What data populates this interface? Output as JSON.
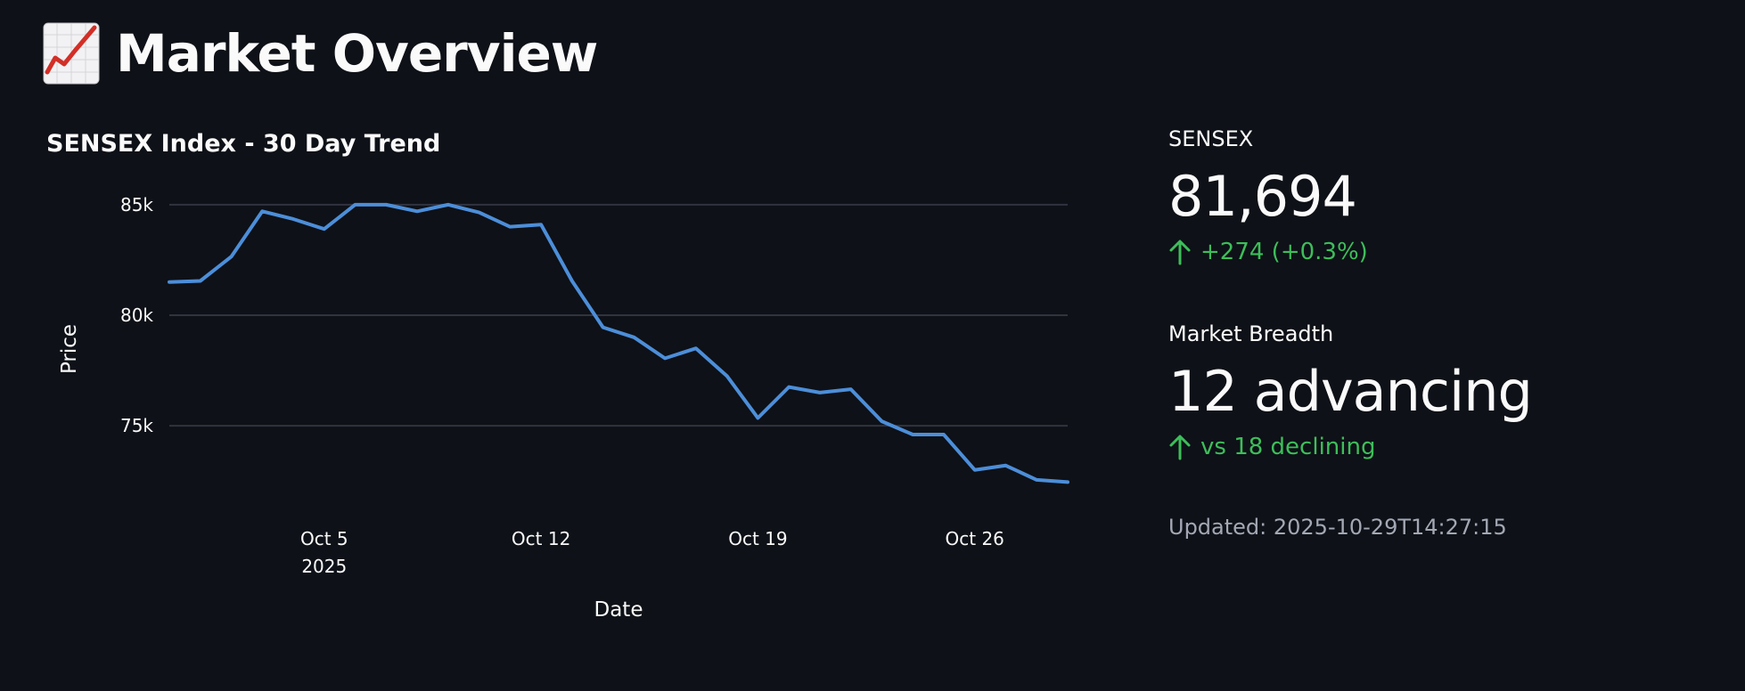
{
  "page": {
    "title": "Market Overview",
    "title_icon": "chart-increasing-icon"
  },
  "chart_section": {
    "title": "SENSEX Index - 30 Day Trend"
  },
  "chart_data": {
    "type": "line",
    "title": "SENSEX Index - 30 Day Trend",
    "xlabel": "Date",
    "ylabel": "Price",
    "x": [
      "2025-09-30",
      "2025-10-01",
      "2025-10-02",
      "2025-10-03",
      "2025-10-04",
      "2025-10-05",
      "2025-10-06",
      "2025-10-07",
      "2025-10-08",
      "2025-10-09",
      "2025-10-10",
      "2025-10-11",
      "2025-10-12",
      "2025-10-13",
      "2025-10-14",
      "2025-10-15",
      "2025-10-16",
      "2025-10-17",
      "2025-10-18",
      "2025-10-19",
      "2025-10-20",
      "2025-10-21",
      "2025-10-22",
      "2025-10-23",
      "2025-10-24",
      "2025-10-25",
      "2025-10-26",
      "2025-10-27",
      "2025-10-28",
      "2025-10-29"
    ],
    "series": [
      {
        "values": [
          81500,
          81550,
          82650,
          84700,
          84350,
          83900,
          85000,
          85000,
          84700,
          85000,
          84650,
          84000,
          84100,
          81550,
          79450,
          79000,
          78050,
          78500,
          77250,
          75350,
          76750,
          76500,
          76650,
          75200,
          74600,
          74600,
          73000,
          73200,
          72550,
          72450
        ],
        "color": "#4c8ed9"
      }
    ],
    "ylim": [
      71700,
      85800
    ],
    "yticks": [
      75000,
      80000,
      85000
    ],
    "ytick_labels": [
      "75k",
      "80k",
      "85k"
    ],
    "xticks": [
      "2025-10-05",
      "2025-10-12",
      "2025-10-19",
      "2025-10-26"
    ],
    "xtick_labels": [
      "Oct 5",
      "Oct 12",
      "Oct 19",
      "Oct 26"
    ],
    "xtick_sublabel": "2025",
    "grid": true,
    "legend": false
  },
  "metrics": [
    {
      "label": "SENSEX",
      "value": "81,694",
      "delta": "+274 (+0.3%)",
      "delta_icon": "arrow-up-icon",
      "delta_color": "#3dbe5a"
    },
    {
      "label": "Market Breadth",
      "value": "12 advancing",
      "delta": "vs 18 declining",
      "delta_icon": "arrow-up-icon",
      "delta_color": "#3dbe5a"
    }
  ],
  "updated_text": "Updated: 2025-10-29T14:27:15",
  "colors": {
    "background": "#0e1117",
    "text": "#fafafa",
    "gridline": "#31333f",
    "muted": "#a3a8b4"
  }
}
